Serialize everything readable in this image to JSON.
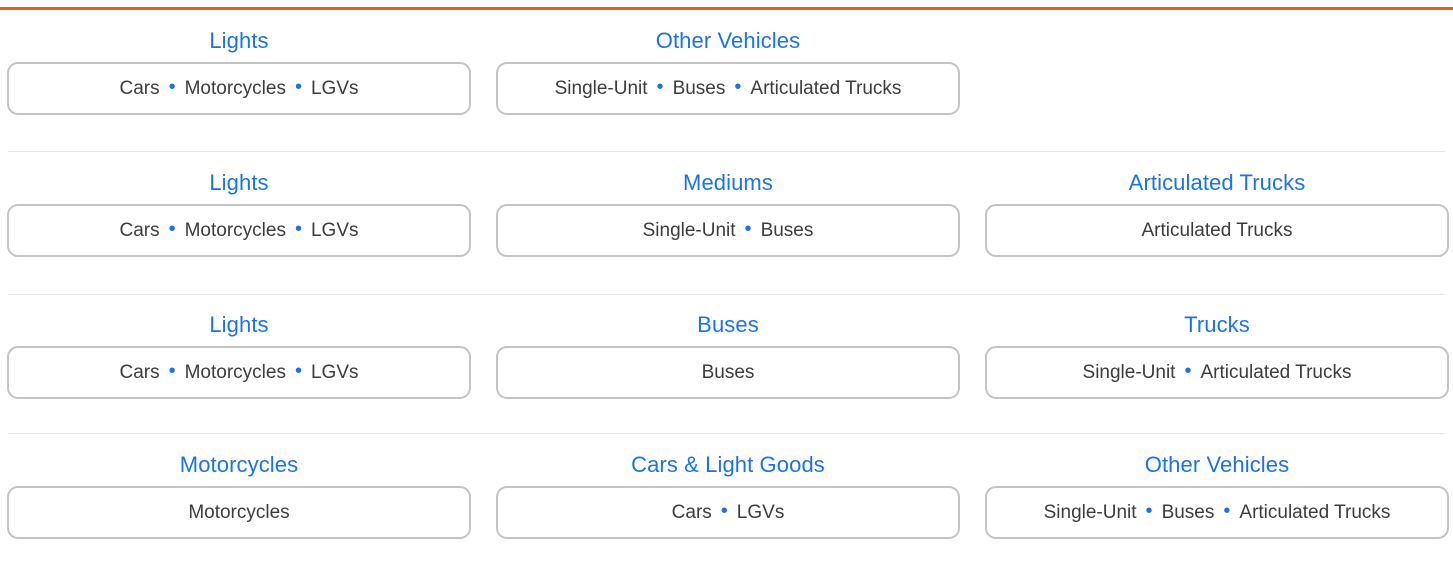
{
  "colors": {
    "accent_bar": "#e0641e",
    "title": "#1a73e8",
    "dot": "#1a73e8",
    "chip_border": "#c4c4c4",
    "chip_text": "#3c3c3c",
    "separator": "#e6e6e6"
  },
  "rows": [
    {
      "groups": [
        {
          "title": "Lights",
          "items": [
            "Cars",
            "Motorcycles",
            "LGVs"
          ]
        },
        {
          "title": "Other Vehicles",
          "items": [
            "Single-Unit",
            "Buses",
            "Articulated Trucks"
          ]
        }
      ]
    },
    {
      "groups": [
        {
          "title": "Lights",
          "items": [
            "Cars",
            "Motorcycles",
            "LGVs"
          ]
        },
        {
          "title": "Mediums",
          "items": [
            "Single-Unit",
            "Buses"
          ]
        },
        {
          "title": "Articulated Trucks",
          "items": [
            "Articulated Trucks"
          ]
        }
      ]
    },
    {
      "groups": [
        {
          "title": "Lights",
          "items": [
            "Cars",
            "Motorcycles",
            "LGVs"
          ]
        },
        {
          "title": "Buses",
          "items": [
            "Buses"
          ]
        },
        {
          "title": "Trucks",
          "items": [
            "Single-Unit",
            "Articulated Trucks"
          ]
        }
      ]
    },
    {
      "groups": [
        {
          "title": "Motorcycles",
          "items": [
            "Motorcycles"
          ]
        },
        {
          "title": "Cars & Light Goods",
          "items": [
            "Cars",
            "LGVs"
          ]
        },
        {
          "title": "Other Vehicles",
          "items": [
            "Single-Unit",
            "Buses",
            "Articulated Trucks"
          ]
        }
      ]
    }
  ]
}
